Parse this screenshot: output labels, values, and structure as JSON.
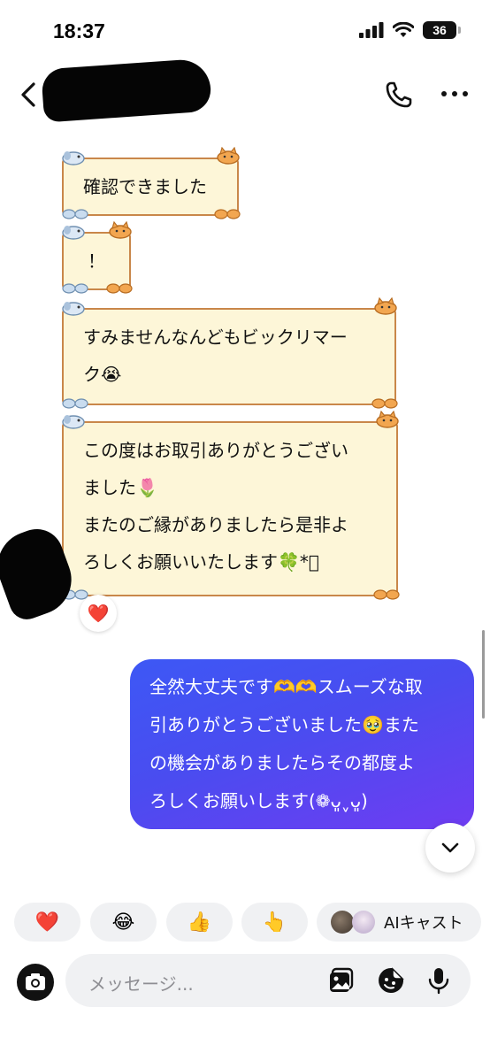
{
  "status_bar": {
    "time": "18:37",
    "battery": "36"
  },
  "header": {
    "icons": [
      "back-icon",
      "phone-icon",
      "more-icon"
    ]
  },
  "messages": {
    "incoming": [
      {
        "lines": [
          "確認できました"
        ]
      },
      {
        "lines": [
          "！"
        ]
      },
      {
        "lines": [
          "すみませんなんどもビックリマー",
          "ク😭"
        ]
      },
      {
        "lines": [
          "この度はお取引ありがとうござい",
          "ました🌷",
          "またのご縁がありましたら是非よ",
          "ろしくお願いいたします🍀*ﾟ"
        ]
      }
    ],
    "reaction": "❤️",
    "outgoing": {
      "lines": [
        "全然大丈夫です🫶🫶スムーズな取",
        "引ありがとうございました🥹また",
        "の機会がありましたらその都度よ",
        "ろしくお願いします(❁ᴗ͈ˬᴗ͈)"
      ]
    }
  },
  "quick_reactions": [
    "❤️",
    "😂",
    "👍",
    "👆",
    "AIキャスト"
  ],
  "composer": {
    "placeholder": "メッセージ..."
  },
  "colors": {
    "theme_bubble": "#fdf6d8",
    "theme_border": "#c9874a",
    "outgoing_start": "#3d58f5",
    "outgoing_end": "#6f3cf2"
  }
}
